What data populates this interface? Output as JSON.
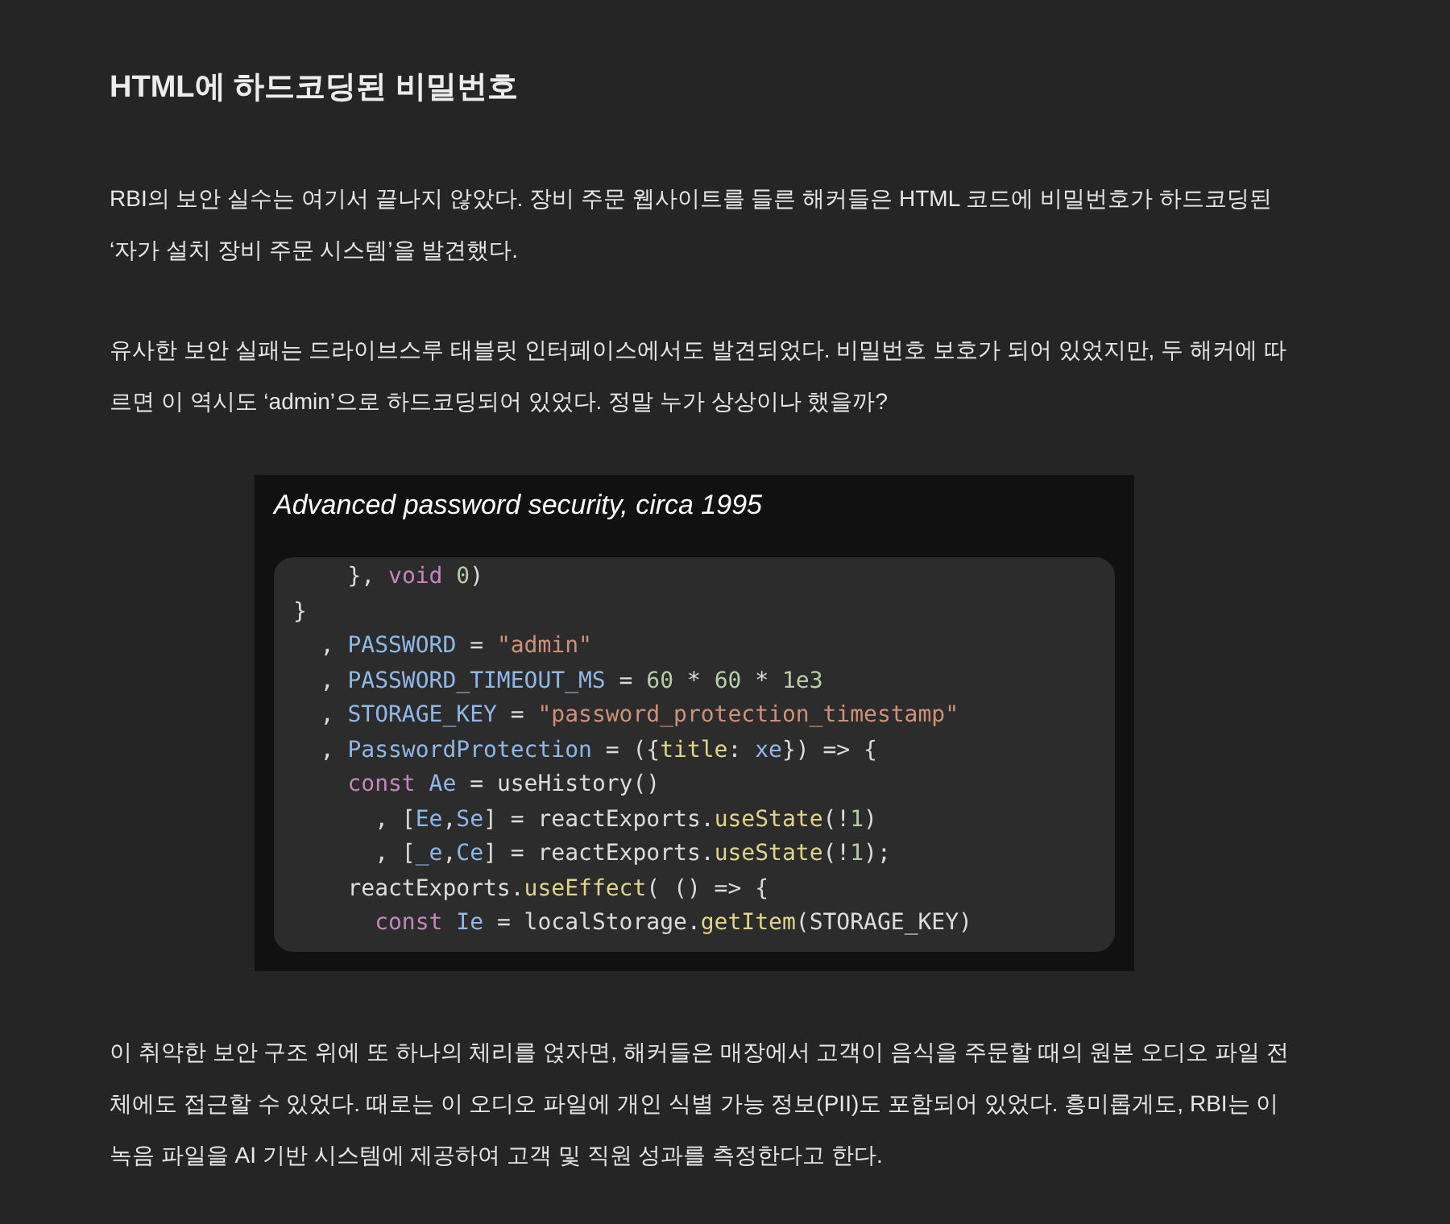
{
  "heading": "HTML에 하드코딩된 비밀번호",
  "paragraphs_before": [
    "RBI의 보안 실수는 여기서 끝나지 않았다. 장비 주문 웹사이트를 들른 해커들은 HTML 코드에 비밀번호가 하드코딩된 ‘자가 설치 장비 주문 시스템’을 발견했다.",
    "유사한 보안 실패는 드라이브스루 태블릿 인터페이스에서도 발견되었다. 비밀번호 보호가 되어 있었지만, 두 해커에 따르면 이 역시도 ‘admin’으로 하드코딩되어 있었다. 정말 누가 상상이나 했을까?"
  ],
  "figure": {
    "caption": "Advanced password security, circa 1995",
    "code_lines": [
      [
        {
          "kind": "plain",
          "text": "    }, "
        },
        {
          "kind": "keyword",
          "text": "void"
        },
        {
          "kind": "number",
          "text": " 0"
        },
        {
          "kind": "plain",
          "text": ")"
        }
      ],
      [
        {
          "kind": "plain",
          "text": "}"
        }
      ],
      [
        {
          "kind": "plain",
          "text": "  , "
        },
        {
          "kind": "variable",
          "text": "PASSWORD"
        },
        {
          "kind": "plain",
          "text": " = "
        },
        {
          "kind": "string",
          "text": "\"admin\""
        }
      ],
      [
        {
          "kind": "plain",
          "text": "  , "
        },
        {
          "kind": "variable",
          "text": "PASSWORD_TIMEOUT_MS"
        },
        {
          "kind": "plain",
          "text": " = "
        },
        {
          "kind": "number",
          "text": "60"
        },
        {
          "kind": "plain",
          "text": " * "
        },
        {
          "kind": "number",
          "text": "60"
        },
        {
          "kind": "plain",
          "text": " * "
        },
        {
          "kind": "number",
          "text": "1e3"
        }
      ],
      [
        {
          "kind": "plain",
          "text": "  , "
        },
        {
          "kind": "variable",
          "text": "STORAGE_KEY"
        },
        {
          "kind": "plain",
          "text": " = "
        },
        {
          "kind": "string",
          "text": "\"password_protection_timestamp\""
        }
      ],
      [
        {
          "kind": "plain",
          "text": "  , "
        },
        {
          "kind": "variable",
          "text": "PasswordProtection"
        },
        {
          "kind": "plain",
          "text": " = ({"
        },
        {
          "kind": "function",
          "text": "title"
        },
        {
          "kind": "plain",
          "text": ": "
        },
        {
          "kind": "variable",
          "text": "xe"
        },
        {
          "kind": "plain",
          "text": "}) => {"
        }
      ],
      [
        {
          "kind": "keyword",
          "text": "    const"
        },
        {
          "kind": "variable",
          "text": " Ae"
        },
        {
          "kind": "plain",
          "text": " = useHistory()"
        }
      ],
      [
        {
          "kind": "plain",
          "text": "      , ["
        },
        {
          "kind": "variable",
          "text": "Ee"
        },
        {
          "kind": "plain",
          "text": ","
        },
        {
          "kind": "variable",
          "text": "Se"
        },
        {
          "kind": "plain",
          "text": "] = reactExports."
        },
        {
          "kind": "function",
          "text": "useState"
        },
        {
          "kind": "plain",
          "text": "(!"
        },
        {
          "kind": "number",
          "text": "1"
        },
        {
          "kind": "plain",
          "text": ")"
        }
      ],
      [
        {
          "kind": "plain",
          "text": "      , ["
        },
        {
          "kind": "variable",
          "text": "_e"
        },
        {
          "kind": "plain",
          "text": ","
        },
        {
          "kind": "variable",
          "text": "Ce"
        },
        {
          "kind": "plain",
          "text": "] = reactExports."
        },
        {
          "kind": "function",
          "text": "useState"
        },
        {
          "kind": "plain",
          "text": "(!"
        },
        {
          "kind": "number",
          "text": "1"
        },
        {
          "kind": "plain",
          "text": ");"
        }
      ],
      [
        {
          "kind": "plain",
          "text": "    reactExports."
        },
        {
          "kind": "function",
          "text": "useEffect"
        },
        {
          "kind": "plain",
          "text": "( () => {"
        }
      ],
      [
        {
          "kind": "keyword",
          "text": "      const"
        },
        {
          "kind": "variable",
          "text": " Ie"
        },
        {
          "kind": "plain",
          "text": " = localStorage."
        },
        {
          "kind": "function",
          "text": "getItem"
        },
        {
          "kind": "plain",
          "text": "(STORAGE_KEY)"
        }
      ]
    ]
  },
  "paragraphs_after": [
    "이 취약한 보안 구조 위에 또 하나의 체리를 얹자면, 해커들은 매장에서 고객이 음식을 주문할 때의 원본 오디오 파일 전체에도 접근할 수 있었다. 때로는 이 오디오 파일에 개인 식별 가능 정보(PII)도 포함되어 있었다. 흥미롭게도, RBI는 이 녹음 파일을 AI 기반 시스템에 제공하여 고객 및 직원 성과를 측정한다고 한다."
  ]
}
